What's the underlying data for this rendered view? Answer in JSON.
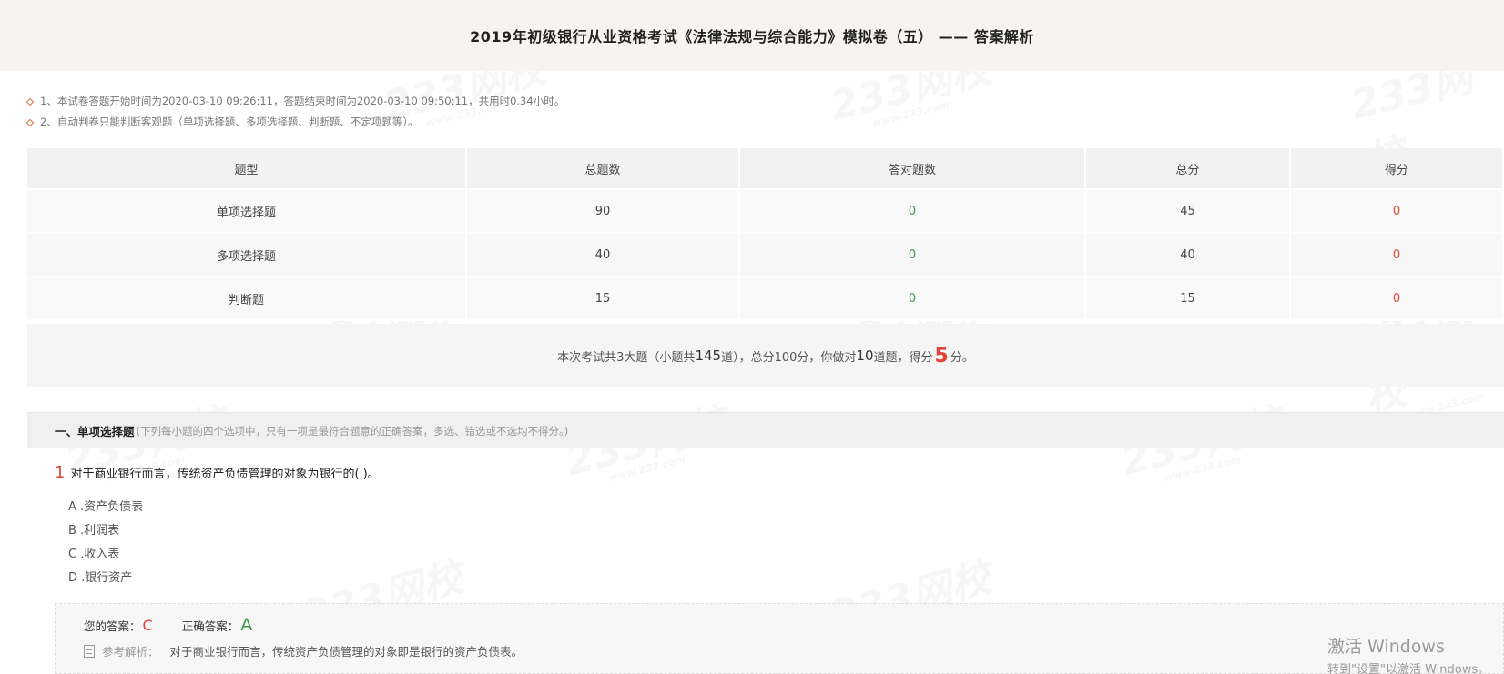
{
  "page": {
    "title": "2019年初级银行从业资格考试《法律法规与综合能力》模拟卷（五） —— 答案解析"
  },
  "notes": [
    "1、本试卷答题开始时间为2020-03-10 09:26:11，答题结束时间为2020-03-10 09:50:11，共用时0.34小时。",
    "2、自动判卷只能判断客观题（单项选择题、多项选择题、判断题、不定项题等）。"
  ],
  "score_table": {
    "headers": [
      "题型",
      "总题数",
      "答对题数",
      "总分",
      "得分"
    ],
    "rows": [
      {
        "type": "单项选择题",
        "total": "90",
        "correct": "0",
        "points": "45",
        "score": "0"
      },
      {
        "type": "多项选择题",
        "total": "40",
        "correct": "0",
        "points": "40",
        "score": "0"
      },
      {
        "type": "判断题",
        "total": "15",
        "correct": "0",
        "points": "15",
        "score": "0"
      }
    ]
  },
  "summary": {
    "part1": "本次考试共3大题（小题共",
    "question_count": "145",
    "part2": "道），总分100分，你做对",
    "correct_count": "10",
    "part3": "道题，得分",
    "score": "5",
    "part4": "分。"
  },
  "section": {
    "title": "一、单项选择题",
    "desc": "(下列每小题的四个选项中，只有一项是最符合题意的正确答案，多选、错选或不选均不得分。)"
  },
  "question": {
    "number": "1",
    "text": "对于商业银行而言，传统资产负债管理的对象为银行的(      )。",
    "options": [
      "A .资产负债表",
      "B .利润表",
      "C .收入表",
      "D .银行资产"
    ]
  },
  "answer": {
    "your_label": "您的答案：",
    "your_value": "C",
    "correct_label": "正确答案：",
    "correct_value": "A",
    "ref_label": "参考解析：",
    "ref_text": "对于商业银行而言，传统资产负债管理的对象即是银行的资产负债表。"
  },
  "watermark": {
    "brand": "233网校",
    "url": "www.233.com"
  },
  "windows_activation": {
    "line1": "激活 Windows",
    "line2": "转到\"设置\"以激活 Windows。"
  },
  "colors": {
    "accent_red": "#e0473a",
    "accent_green": "#3b9a4a",
    "header_bg": "#f7f3ef"
  }
}
